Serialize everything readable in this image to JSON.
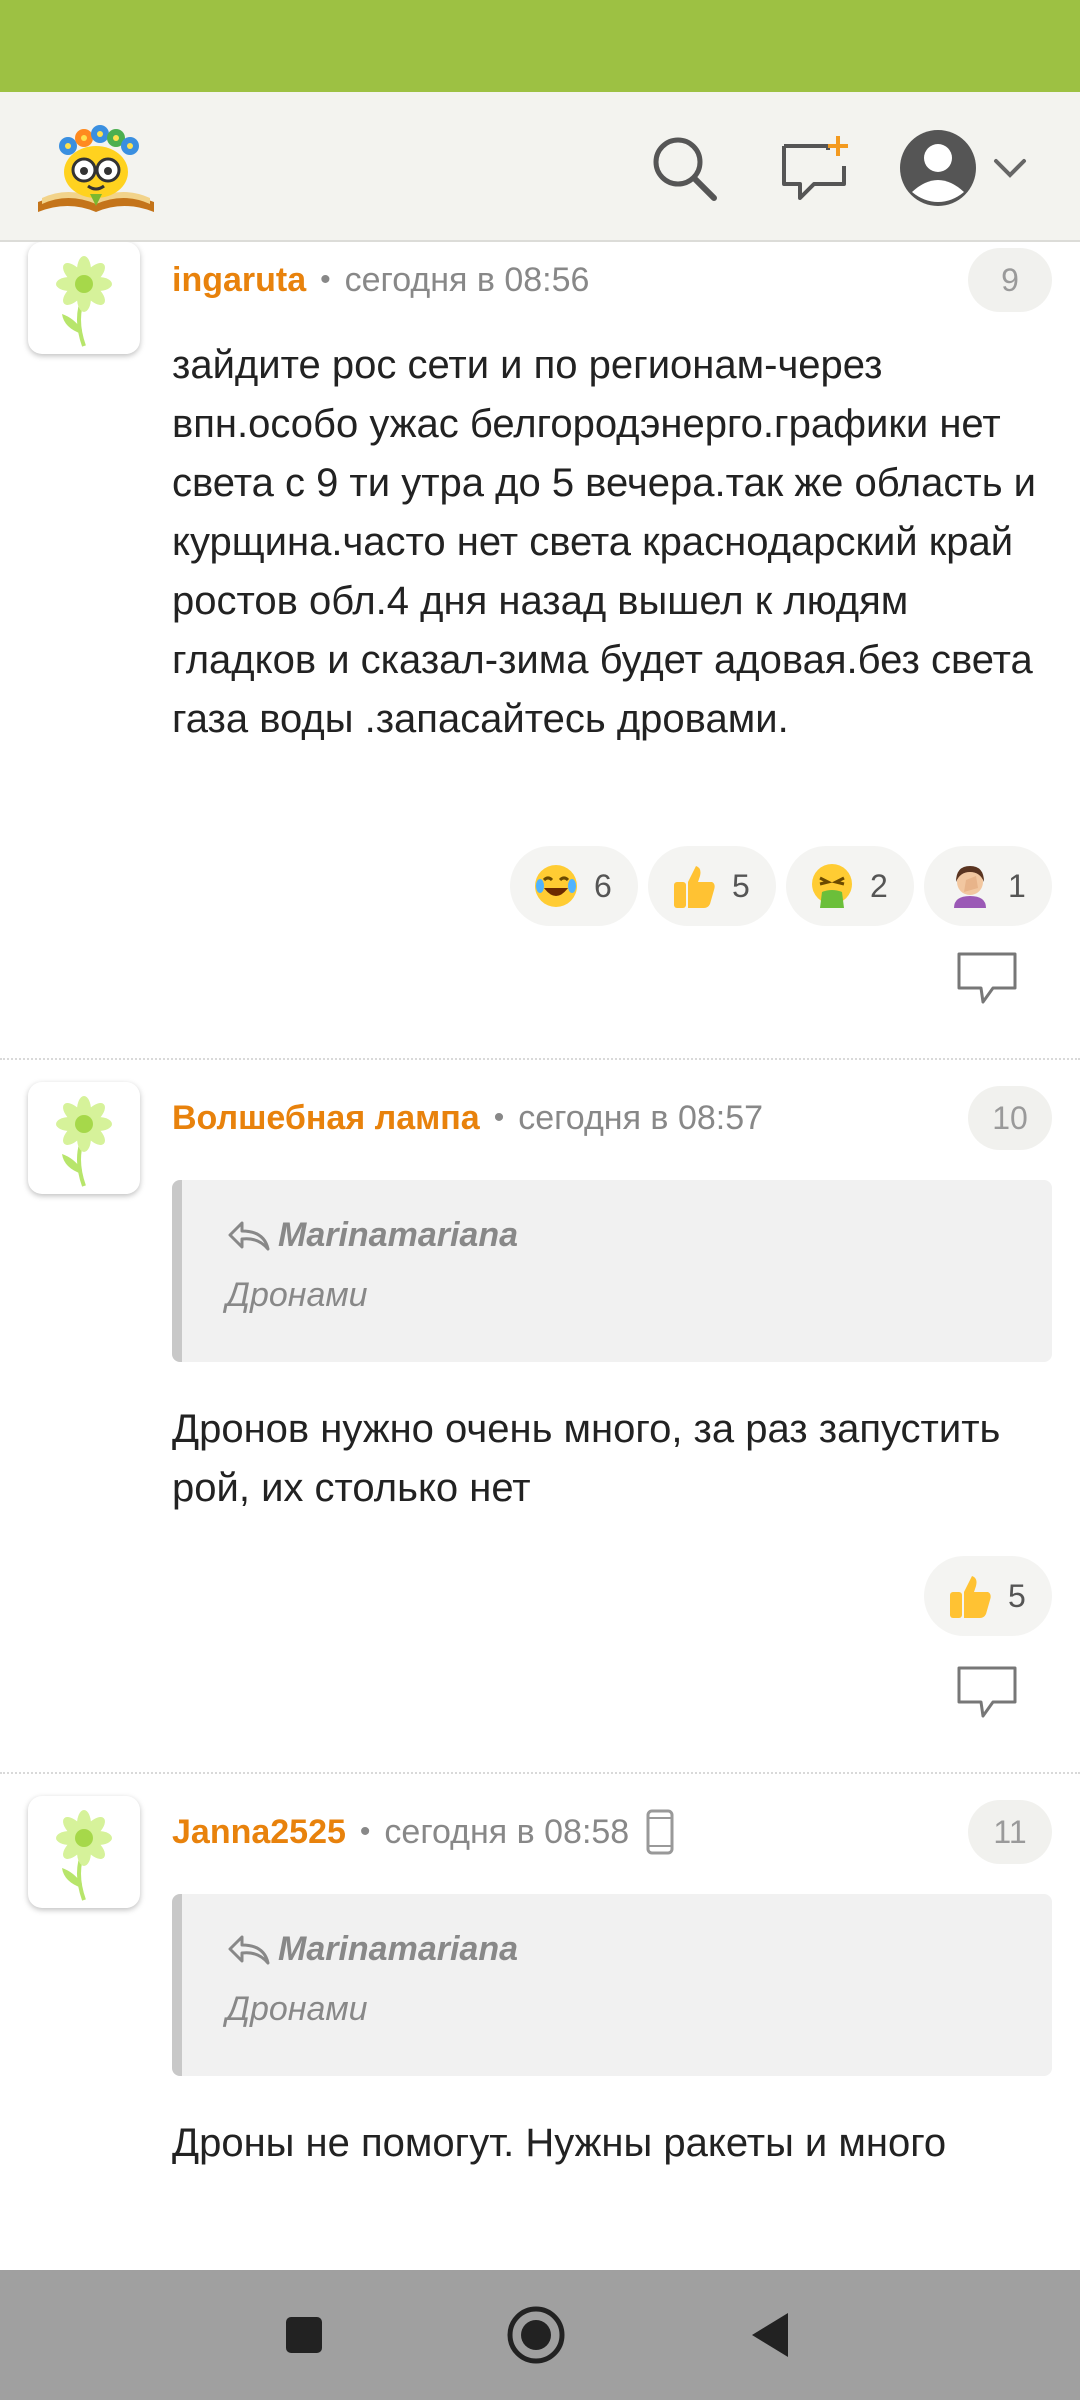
{
  "app": {
    "brand_color": "#9dc143",
    "accent_color": "#e8820c"
  },
  "header": {
    "icons": [
      "logo-icon",
      "search-icon",
      "new-post-icon",
      "profile-avatar-icon",
      "chevron-down-icon"
    ]
  },
  "comments": [
    {
      "author": "ingaruta",
      "time": "сегодня в 08:56",
      "number": "9",
      "text": "зайдите рос сети и по регионам-через впн.особо ужас белгородэнерго.графики нет света с 9 ти утра до 5 вечера.так же область и курщина.часто нет света краснодарский край ростов обл.4 дня назад вышел к людям гладков и сказал-зима будет адовая.без света газа воды .запасайтесь дровами.",
      "reactions": [
        {
          "emoji": "😂",
          "count": "6"
        },
        {
          "emoji": "👍",
          "count": "5"
        },
        {
          "emoji": "🤮",
          "count": "2"
        },
        {
          "emoji": "🤦‍♀️",
          "count": "1"
        }
      ]
    },
    {
      "author": "Волшебная лампа",
      "time": "сегодня в 08:57",
      "number": "10",
      "quote": {
        "author": "Marinamariana",
        "text": "Дронами"
      },
      "text": "Дронов нужно очень много, за раз запустить рой, их столько нет",
      "reactions": [
        {
          "emoji": "👍",
          "count": "5"
        }
      ]
    },
    {
      "author": "Janna2525",
      "time": "сегодня в 08:58",
      "number": "11",
      "device": "mobile-device-icon",
      "quote": {
        "author": "Marinamariana",
        "text": "Дронами"
      },
      "text": "Дроны не помогут. Нужны ракеты и много"
    }
  ],
  "navbar": {
    "icons": [
      "recent-apps-icon",
      "home-icon",
      "back-icon"
    ]
  }
}
